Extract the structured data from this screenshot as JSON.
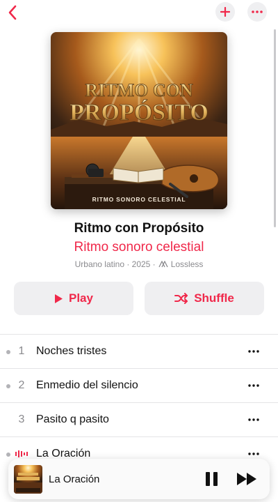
{
  "colors": {
    "accent": "#f0284a",
    "button_bg": "#efeff1",
    "secondary_text": "#8a8a8e"
  },
  "album": {
    "cover_title_line1": "RITMO CON",
    "cover_title_line2": "PROPÓSITO",
    "cover_caption": "RITMO SONORO CELESTIAL",
    "title": "Ritmo con Propósito",
    "artist": "Ritmo sonoro celestial",
    "meta": "Urbano latino · 2025 ·",
    "quality": "Lossless"
  },
  "actions": {
    "play_label": "Play",
    "shuffle_label": "Shuffle"
  },
  "tracks": [
    {
      "number": "1",
      "title": "Noches tristes"
    },
    {
      "number": "2",
      "title": "Enmedio del silencio"
    },
    {
      "number": "3",
      "title": "Pasito q pasito"
    },
    {
      "number": "",
      "title": "La Oración"
    }
  ],
  "now_playing": {
    "title": "La Oración"
  },
  "icons": {
    "back": "chevron-left-icon",
    "add": "plus-icon",
    "more": "ellipsis-icon",
    "play": "play-icon",
    "shuffle": "shuffle-icon",
    "lossless": "lossless-icon",
    "pause": "pause-icon",
    "next": "forward-icon"
  }
}
